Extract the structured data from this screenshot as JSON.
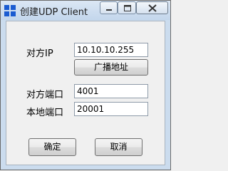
{
  "window": {
    "title": "创建UDP Client"
  },
  "form": {
    "peer_ip_label": "对方IP",
    "peer_ip_value": "10.10.10.255",
    "broadcast_button": "广播地址",
    "peer_port_label": "对方端口",
    "peer_port_value": "4001",
    "local_port_label": "本地端口",
    "local_port_value": "20001"
  },
  "buttons": {
    "ok": "确定",
    "cancel": "取消"
  },
  "icons": {
    "app": "windows-logo-icon",
    "minimize": "minimize-icon",
    "maximize": "maximize-icon",
    "close": "close-icon"
  },
  "colors": {
    "titlebar": "#c3d6ec",
    "dialog_bg": "#f0f0f0",
    "app_icon_blue": "#1a5bd1"
  }
}
